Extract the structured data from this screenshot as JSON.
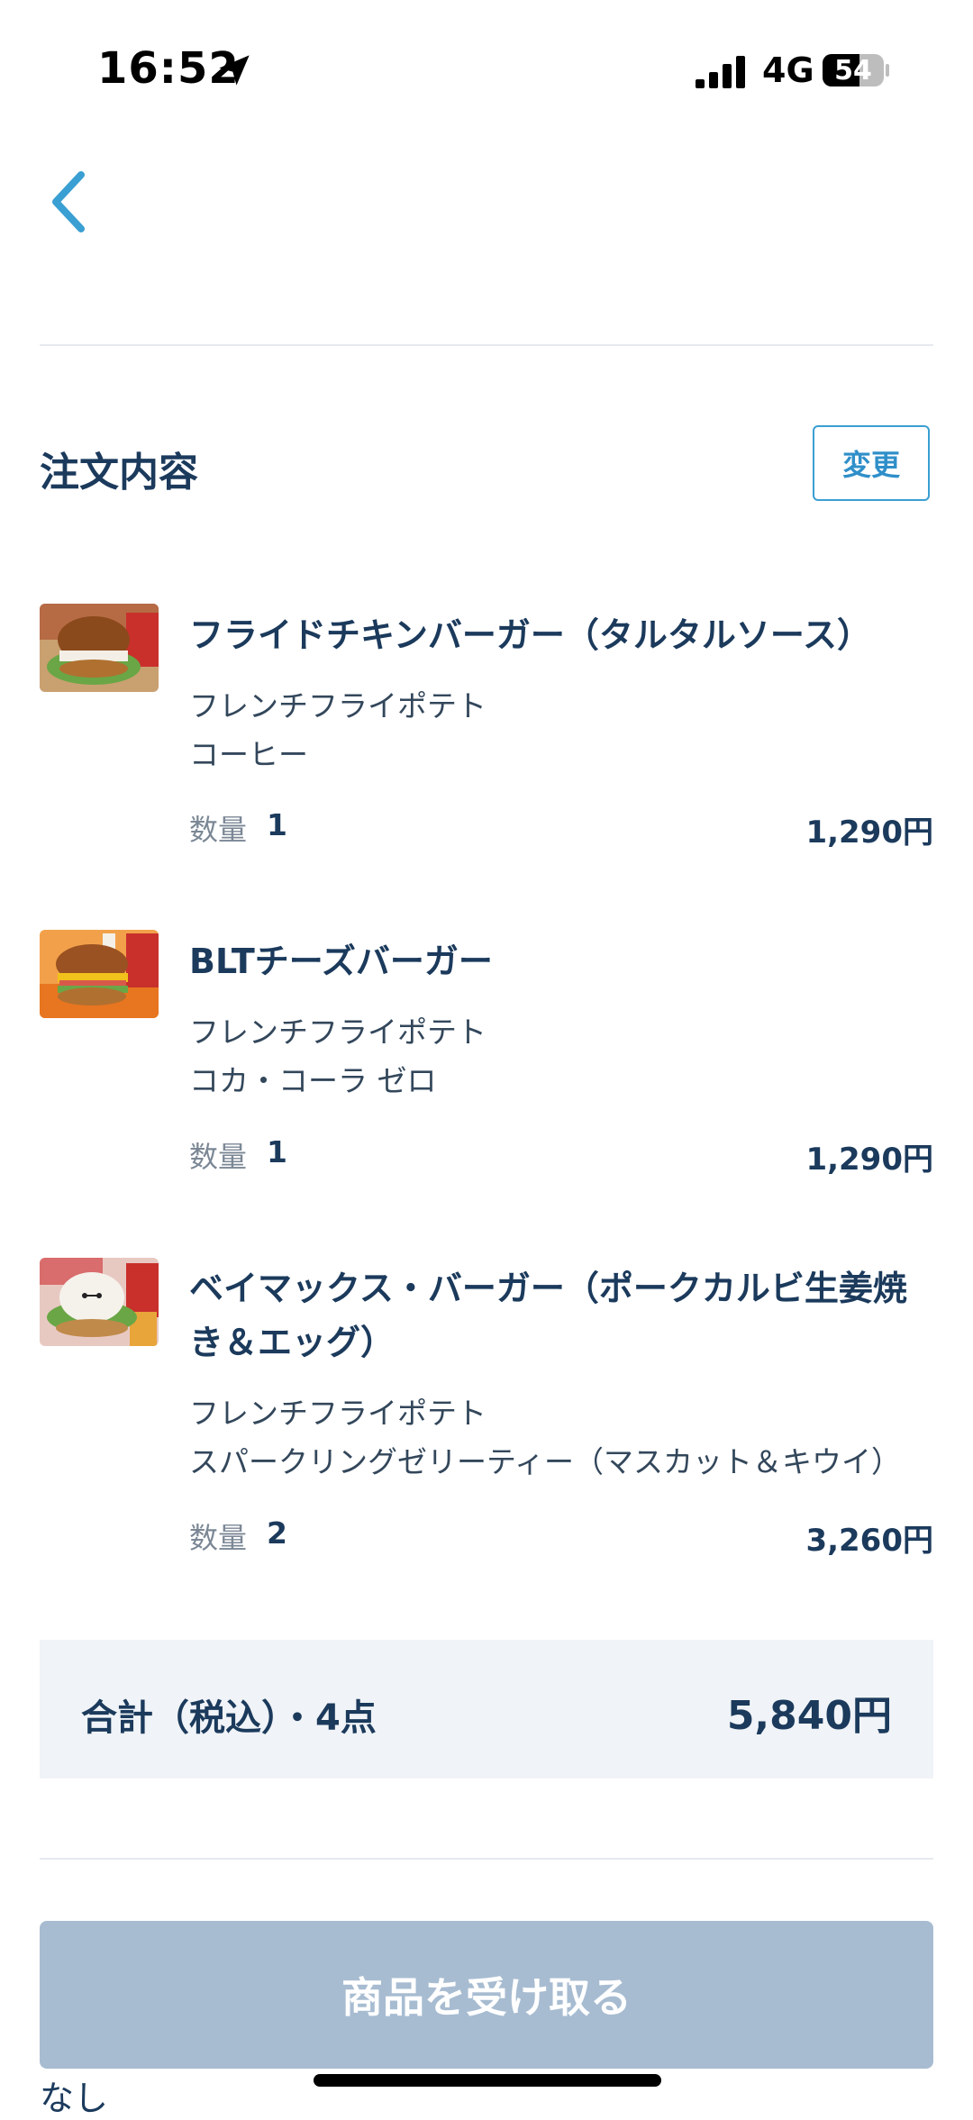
{
  "status_bar": {
    "time": "16:52",
    "network": "4G",
    "battery": "54"
  },
  "icons": {
    "location": "location-arrow-icon",
    "signal": "cellular-signal-icon",
    "battery": "battery-icon",
    "back": "chevron-left-icon"
  },
  "colors": {
    "accent": "#3a9fd2",
    "text": "#1b3a5c",
    "button_disabled": "#a7bcd1",
    "total_bg": "#f0f3f7"
  },
  "order": {
    "title": "注文内容",
    "change_label": "変更",
    "qty_label": "数量",
    "items": [
      {
        "name": "フライドチキンバーガー（タルタルソース）",
        "options": [
          "フレンチフライポテト",
          "コーヒー"
        ],
        "qty": "1",
        "price": "1,290円"
      },
      {
        "name": "BLTチーズバーガー",
        "options": [
          "フレンチフライポテト",
          "コカ・コーラ ゼロ"
        ],
        "qty": "1",
        "price": "1,290円"
      },
      {
        "name_line1": "ベイマックス・バーガー（ポークカルビ生姜焼",
        "name_line2": "き＆エッグ）",
        "options": [
          "フレンチフライポテト",
          "スパークリングゼリーティー（マスカット＆キウイ）"
        ],
        "qty": "2",
        "price": "3,260円"
      }
    ]
  },
  "total": {
    "label": "合計（税込）・4点",
    "value": "5,840円"
  },
  "receive_button": "商品を受け取る",
  "below_text": "なし"
}
